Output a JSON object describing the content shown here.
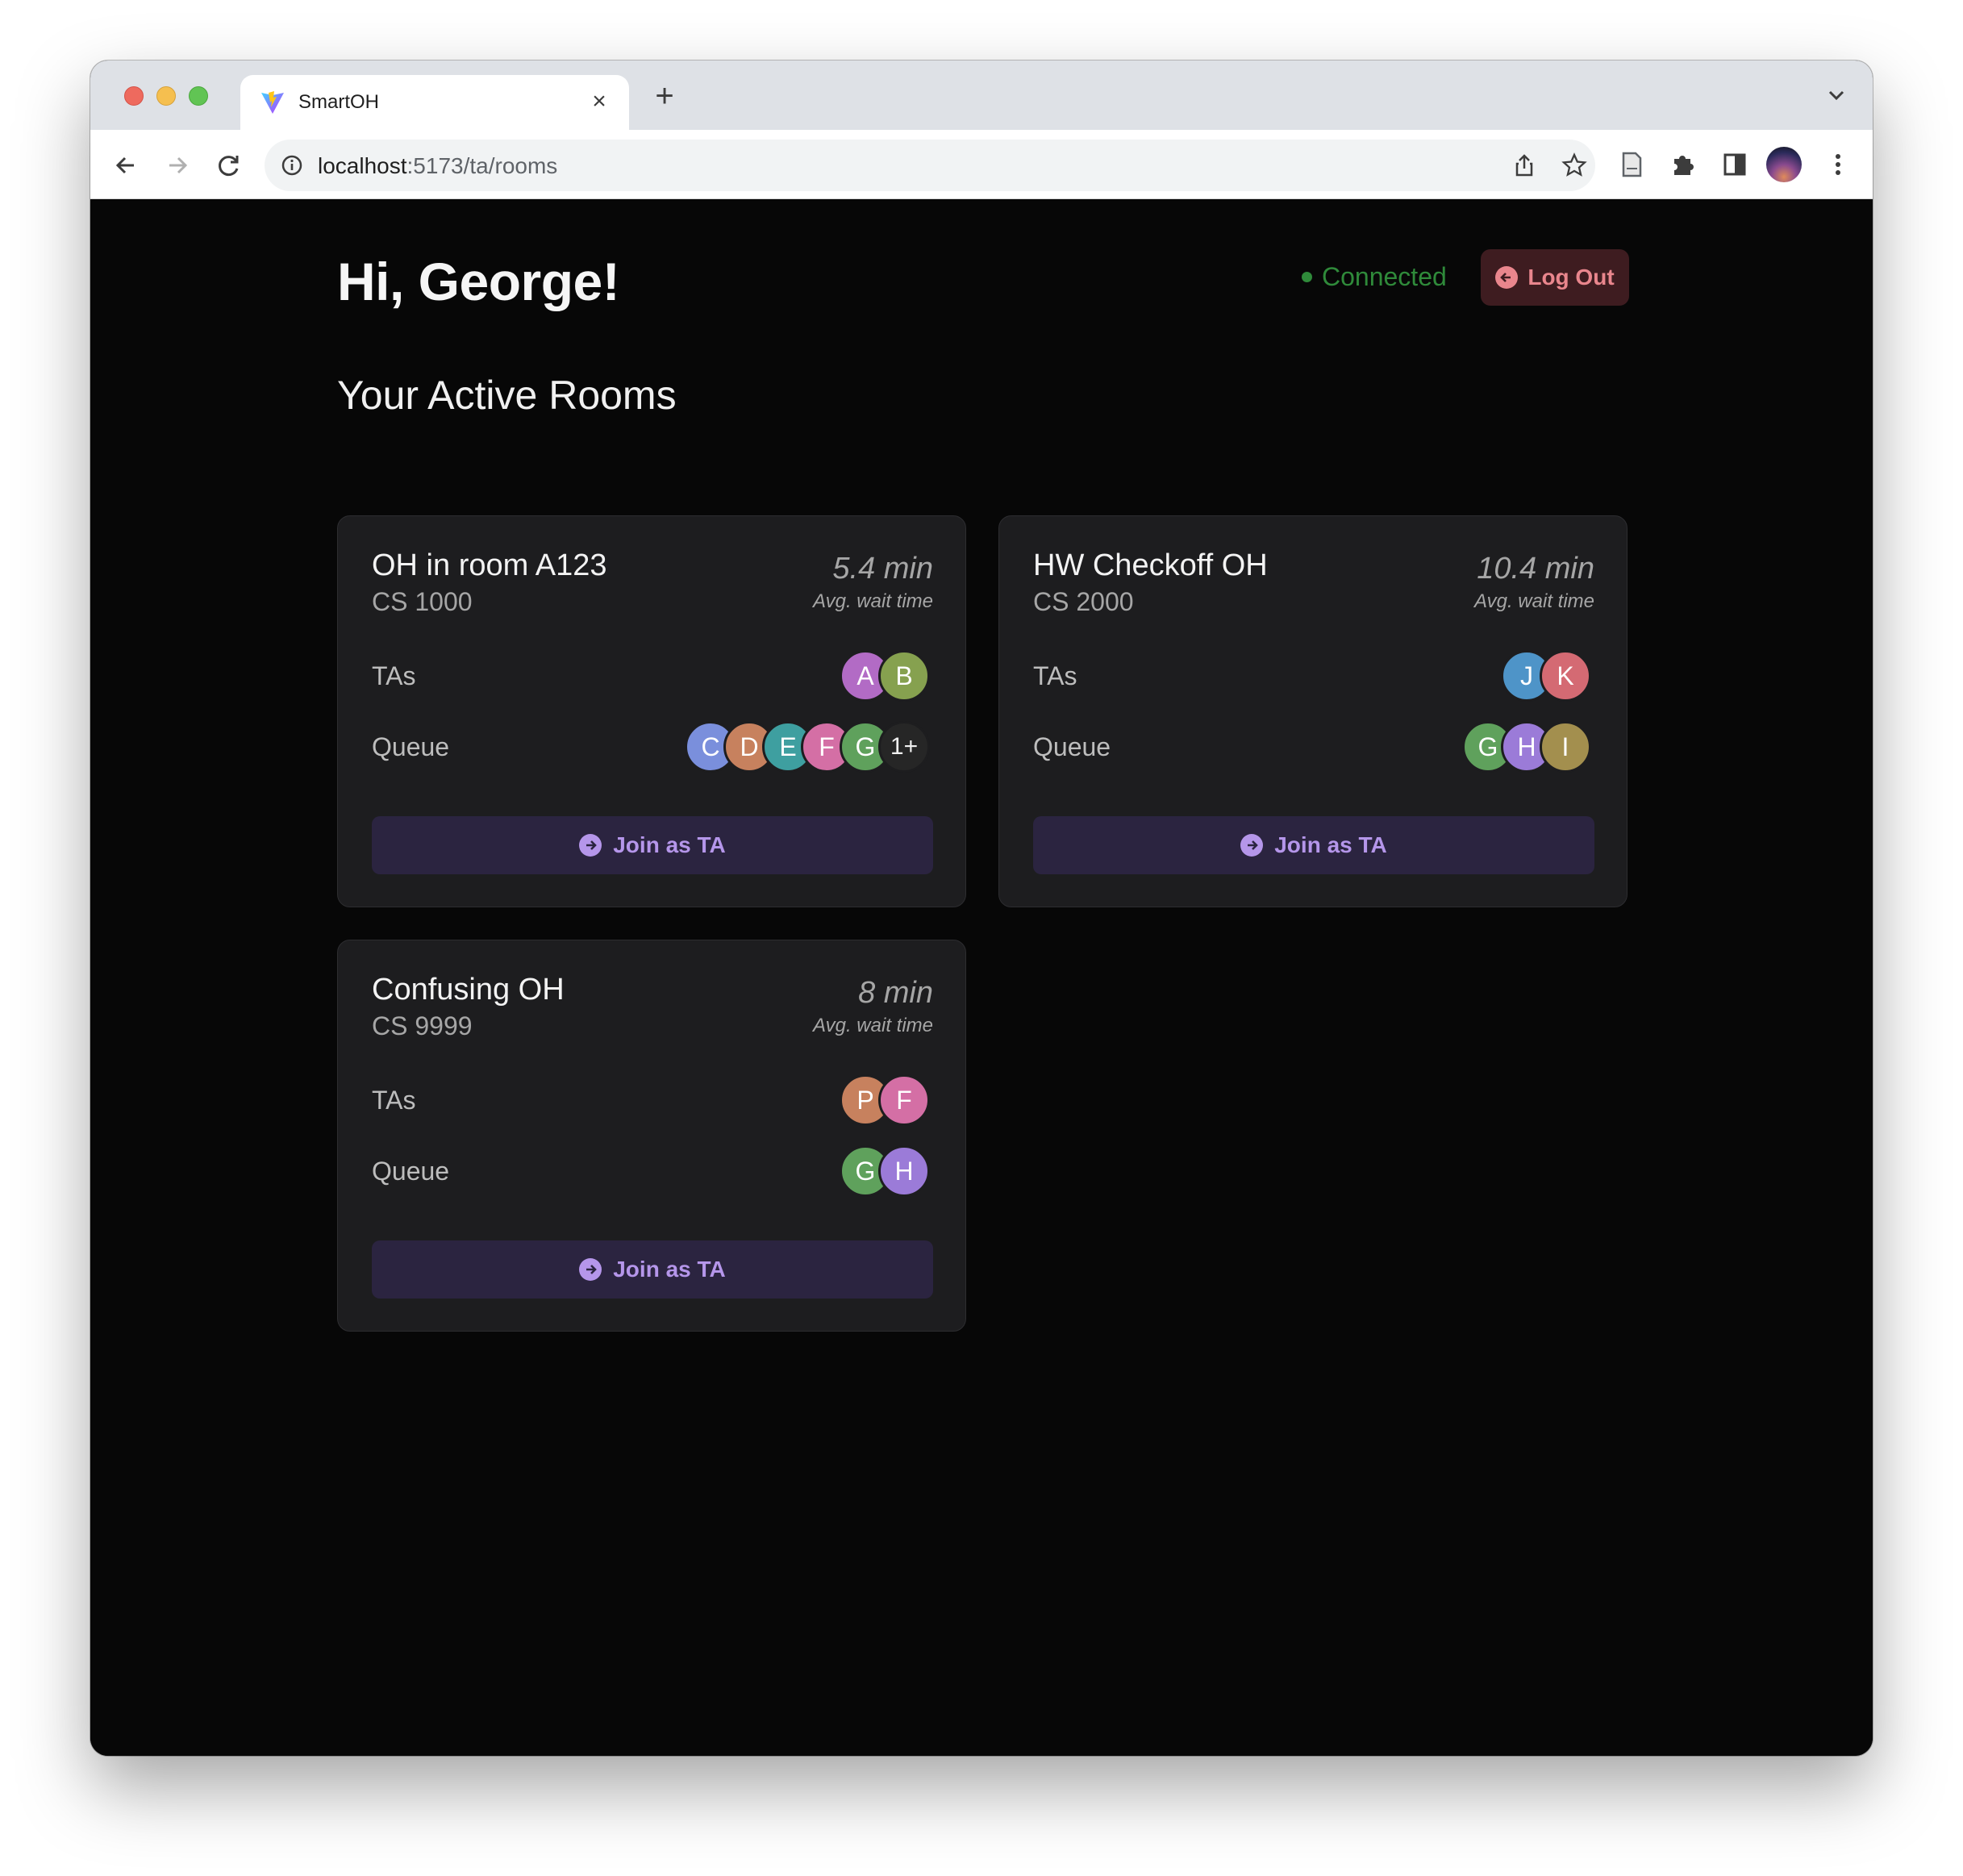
{
  "browser": {
    "tab_title": "SmartOH",
    "url_host": "localhost",
    "url_path": ":5173/ta/rooms"
  },
  "header": {
    "greeting": "Hi, George!",
    "status": "Connected",
    "logout_label": "Log Out"
  },
  "section_title": "Your Active Rooms",
  "labels": {
    "tas": "TAs",
    "queue": "Queue",
    "avg_wait": "Avg. wait time",
    "join": "Join as TA"
  },
  "colors": {
    "connected": "#2f8a3a",
    "logout_bg": "#3e1c20",
    "logout_fg": "#e9868d",
    "join_bg": "#2b2440",
    "join_fg": "#b596ea",
    "avatar_A": "#b26bc5",
    "avatar_B": "#86a14f",
    "avatar_C": "#7a8fdc",
    "avatar_D": "#c7815e",
    "avatar_E": "#3e9fa0",
    "avatar_F": "#d46fa5",
    "avatar_G": "#5fa15c",
    "avatar_H": "#9b7bd8",
    "avatar_I": "#a38f4e",
    "avatar_J": "#4e94c8",
    "avatar_K": "#d46a73",
    "avatar_P": "#c7815e"
  },
  "rooms": [
    {
      "title": "OH in room A123",
      "course": "CS 1000",
      "wait": "5.4 min",
      "tas": [
        "A",
        "B"
      ],
      "queue": [
        "C",
        "D",
        "E",
        "F",
        "G"
      ],
      "queue_more": "1+"
    },
    {
      "title": "HW Checkoff OH",
      "course": "CS 2000",
      "wait": "10.4 min",
      "tas": [
        "J",
        "K"
      ],
      "queue": [
        "G",
        "H",
        "I"
      ],
      "queue_more": ""
    },
    {
      "title": "Confusing OH",
      "course": "CS 9999",
      "wait": "8 min",
      "tas": [
        "P",
        "F"
      ],
      "queue": [
        "G",
        "H"
      ],
      "queue_more": ""
    }
  ]
}
